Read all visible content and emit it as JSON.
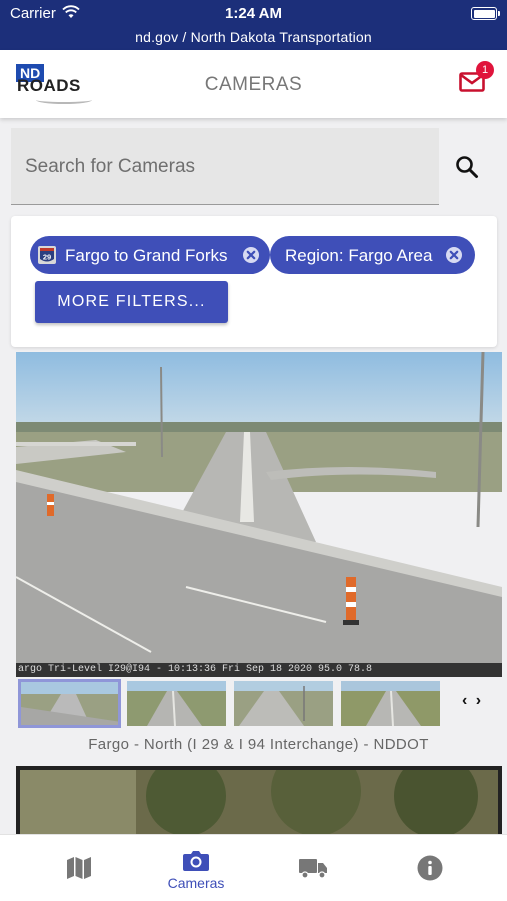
{
  "status_bar": {
    "carrier": "Carrier",
    "time": "1:24 AM",
    "url": "nd.gov / North Dakota Transportation"
  },
  "header": {
    "logo_nd": "ND",
    "logo_roads": "ROADS",
    "title": "CAMERAS",
    "notification_count": "1"
  },
  "search": {
    "placeholder": "Search for Cameras"
  },
  "filters": {
    "chips": [
      {
        "label": "Fargo to Grand Forks",
        "shield": "29"
      },
      {
        "label": "Region: Fargo Area"
      }
    ],
    "more_label": "MORE FILTERS..."
  },
  "camera": {
    "overlay": "argo Tri-Level I29@I94 - 10:13:36 Fri Sep 18 2020 95.0  78.8",
    "caption": "Fargo - North (I 29 & I 94 Interchange) - NDDOT",
    "selected_thumbnail": 1,
    "thumbnail_count": 4
  },
  "tabs": [
    {
      "icon": "map-icon",
      "label": ""
    },
    {
      "icon": "camera-icon",
      "label": "Cameras",
      "active": true
    },
    {
      "icon": "truck-icon",
      "label": ""
    },
    {
      "icon": "info-icon",
      "label": ""
    }
  ],
  "colors": {
    "status_bar": "#1c2f7a",
    "accent": "#3f4fb8",
    "badge": "#e0143c",
    "mail": "#c8102e"
  }
}
